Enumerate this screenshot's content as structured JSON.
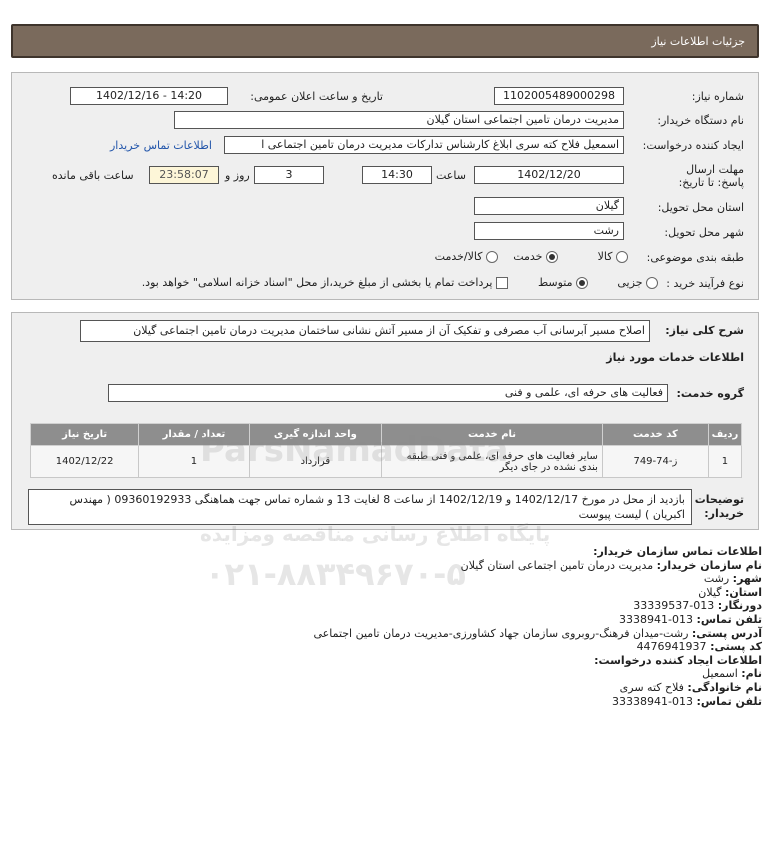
{
  "header": {
    "title": "جزئیات اطلاعات نیاز"
  },
  "form": {
    "need_number_label": "شماره نیاز:",
    "need_number": "1102005489000298",
    "announce_label": "تاریخ و ساعت اعلان عمومی:",
    "announce_value": "1402/12/16 - 14:20",
    "buyer_org_label": "نام دستگاه خریدار:",
    "buyer_org": "مدیریت درمان تامین اجتماعی استان گیلان",
    "creator_label": "ایجاد کننده درخواست:",
    "creator": "اسمعیل فلاح کته سری ابلاغ کارشناس تدارکات مدیریت درمان تامین اجتماعی ا",
    "contact_link": "اطلاعات تماس خریدار",
    "deadline_label": "مهلت ارسال پاسخ: تا تاریخ:",
    "deadline_date": "1402/12/20",
    "time_label": "ساعت",
    "deadline_time": "14:30",
    "days_value": "3",
    "days_label": "روز و",
    "remaining_time": "23:58:07",
    "remaining_label": "ساعت باقی مانده",
    "province_label": "استان محل تحویل:",
    "province": "گیلان",
    "city_label": "شهر محل تحویل:",
    "city": "رشت",
    "category_label": "طبقه بندی موضوعی:",
    "category_options": [
      "کالا",
      "خدمت",
      "کالا/خدمت"
    ],
    "process_label": "نوع فرآیند خرید :",
    "process_options": [
      "جزیی",
      "متوسط"
    ],
    "payment_note": "پرداخت تمام یا بخشی از مبلغ خرید،از محل \"اسناد خزانه اسلامی\" خواهد بود."
  },
  "details": {
    "summary_label": "شرح کلی نیاز:",
    "summary": "اصلاح مسیر آبرسانی آب مصرفی و تفکیک آن از مسیر آتش نشانی ساختمان مدیریت درمان تامین اجتماعی گیلان",
    "services_heading": "اطلاعات خدمات مورد نیاز",
    "service_group_label": "گروه خدمت:",
    "service_group": "فعالیت های حرفه ای، علمی و فنی",
    "table": {
      "headers": [
        "ردیف",
        "کد خدمت",
        "نام خدمت",
        "واحد اندازه گیری",
        "تعداد / مقدار",
        "تاریخ نیاز"
      ],
      "rows": [
        [
          "1",
          "ز-74-749",
          "سایر فعالیت های حرفه ای، علمی و فنی طبقه بندی نشده در جای دیگر",
          "قرارداد",
          "1",
          "1402/12/22"
        ]
      ]
    },
    "notes_label": "توضیحات خریدار:",
    "notes": "بازدید از محل در مورخ 1402/12/17 و 1402/12/19 از ساعت 8 لغایت 13 و شماره تماس جهت هماهنگی 09360192933 ( مهندس اکبریان ) لیست پیوست"
  },
  "contact": {
    "org_heading": "اطلاعات تماس سازمان خریدار:",
    "org_name_label": "نام سازمان خریدار:",
    "org_name": "مدیریت درمان تامین اجتماعی استان گیلان",
    "city_label": "شهر:",
    "city": "رشت",
    "province_label": "استان:",
    "province": "گیلان",
    "fax_label": "دورنگار:",
    "fax": "013-33339537",
    "phone_label": "تلفن تماس:",
    "phone": "013-3338941",
    "address_label": "آدرس پستی:",
    "address": "رشت-میدان فرهنگ-روبروی سازمان جهاد کشاورزی-مدیریت درمان تامین اجتماعی",
    "postal_label": "کد پستی:",
    "postal": "4476941937",
    "creator_heading": "اطلاعات ایجاد کننده درخواست:",
    "first_name_label": "نام:",
    "first_name": "اسمعیل",
    "last_name_label": "نام خانوادگی:",
    "last_name": "فلاح کته سری",
    "creator_phone_label": "تلفن تماس:",
    "creator_phone": "013-33338941"
  },
  "watermark": {
    "line1": "ParsNamadData",
    "line2": "پایگاه اطلاع رسانی مناقصه ومزایده",
    "phone": "۰۲۱-۸۸۳۴۹۶۷۰-۵"
  }
}
